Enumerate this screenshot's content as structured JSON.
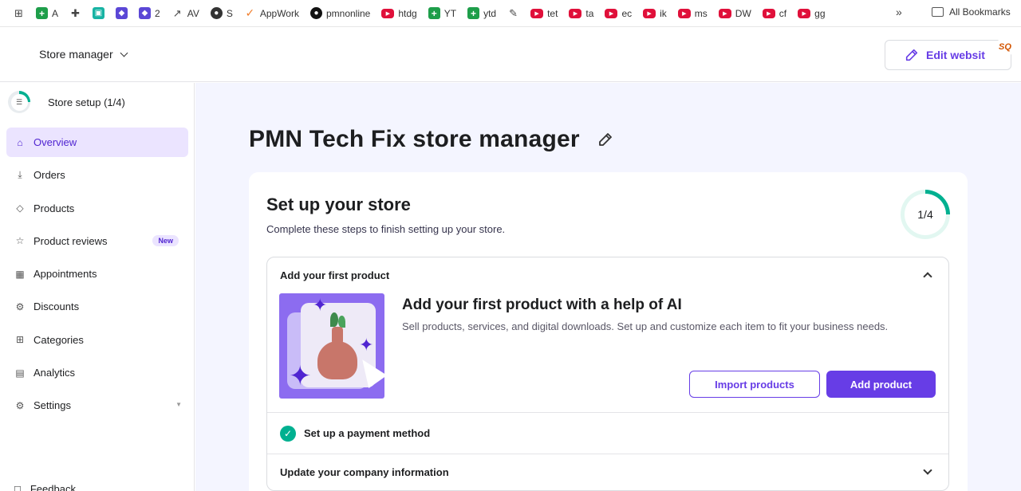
{
  "bookmarks": [
    {
      "label": "",
      "icon": "apps-grid-icon"
    },
    {
      "label": "A",
      "icon": "sheets-icon"
    },
    {
      "label": "",
      "icon": "extension-icon"
    },
    {
      "label": "",
      "icon": "teal-app-icon"
    },
    {
      "label": "",
      "icon": "purple-app-icon"
    },
    {
      "label": "2",
      "icon": "purple-app-icon"
    },
    {
      "label": "AV",
      "icon": "trend-icon"
    },
    {
      "label": "S",
      "icon": "globe-icon"
    },
    {
      "label": "AppWork",
      "icon": "check-icon"
    },
    {
      "label": "pmnonline",
      "icon": "github-icon"
    },
    {
      "label": "htdg",
      "icon": "youtube-icon"
    },
    {
      "label": "YT",
      "icon": "sheets-icon"
    },
    {
      "label": "ytd",
      "icon": "sheets-icon"
    },
    {
      "label": "",
      "icon": "pin-icon"
    },
    {
      "label": "tet",
      "icon": "youtube-icon"
    },
    {
      "label": "ta",
      "icon": "youtube-icon"
    },
    {
      "label": "ec",
      "icon": "youtube-icon"
    },
    {
      "label": "ik",
      "icon": "youtube-icon"
    },
    {
      "label": "ms",
      "icon": "youtube-icon"
    },
    {
      "label": "DW",
      "icon": "youtube-icon"
    },
    {
      "label": "cf",
      "icon": "youtube-icon"
    },
    {
      "label": "gg",
      "icon": "youtube-icon"
    }
  ],
  "bookmarks_more": "»",
  "all_bookmarks": "All Bookmarks",
  "header": {
    "store_switch": "Store manager",
    "edit_website": "Edit websit",
    "sq_badge": "SQ"
  },
  "sidebar": {
    "setup_label": "Store setup (1/4)",
    "setup_progress": 0.25,
    "items": [
      {
        "label": "Overview",
        "icon": "home-icon",
        "active": true
      },
      {
        "label": "Orders",
        "icon": "download-icon"
      },
      {
        "label": "Products",
        "icon": "tag-icon"
      },
      {
        "label": "Product reviews",
        "icon": "star-icon",
        "badge": "New"
      },
      {
        "label": "Appointments",
        "icon": "calendar-icon"
      },
      {
        "label": "Discounts",
        "icon": "discount-icon"
      },
      {
        "label": "Categories",
        "icon": "grid-icon"
      },
      {
        "label": "Analytics",
        "icon": "chart-icon"
      },
      {
        "label": "Settings",
        "icon": "gear-icon",
        "caret": "▼"
      }
    ],
    "feedback": "Feedback"
  },
  "main": {
    "page_title": "PMN Tech Fix store manager",
    "card": {
      "title": "Set up your store",
      "subtitle": "Complete these steps to finish setting up your store.",
      "progress_label": "1/4",
      "progress": 0.25,
      "step1": {
        "title": "Add your first product",
        "body_title": "Add your first product with a help of AI",
        "body_text": "Sell products, services, and digital downloads. Set up and customize each item to fit your business needs.",
        "import_button": "Import products",
        "add_button": "Add product"
      },
      "step2": {
        "title": "Set up a payment method"
      },
      "step3": {
        "title": "Update your company information"
      }
    }
  },
  "colors": {
    "accent": "#673de6",
    "success": "#00b090",
    "active_bg": "#ebe4ff",
    "main_bg": "#f4f5ff"
  }
}
